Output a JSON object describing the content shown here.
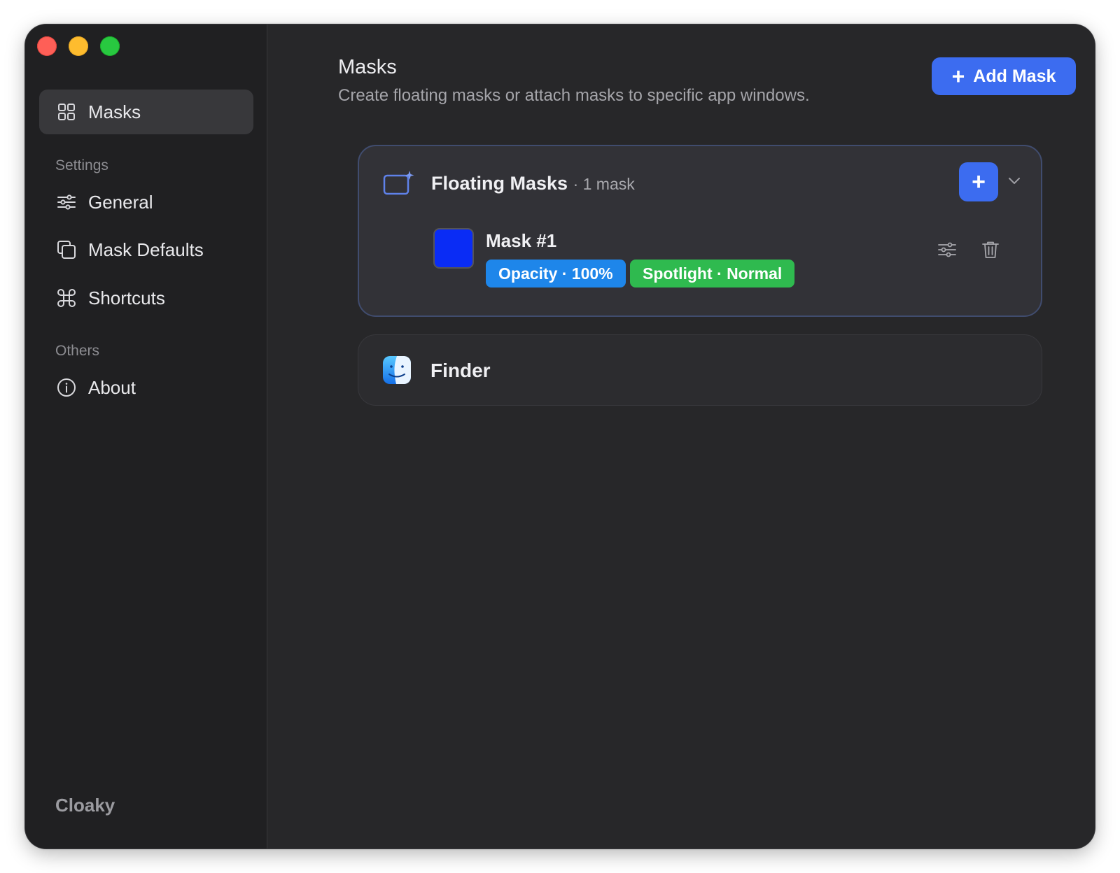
{
  "window": {
    "app_name": "Cloaky"
  },
  "sidebar": {
    "items": [
      {
        "label": "Masks",
        "icon": "grid-icon",
        "active": true
      }
    ],
    "sections": [
      {
        "label": "Settings",
        "items": [
          {
            "label": "General",
            "icon": "sliders-icon"
          },
          {
            "label": "Mask Defaults",
            "icon": "copy-icon"
          },
          {
            "label": "Shortcuts",
            "icon": "command-icon"
          }
        ]
      },
      {
        "label": "Others",
        "items": [
          {
            "label": "About",
            "icon": "info-icon"
          }
        ]
      }
    ]
  },
  "main": {
    "title": "Masks",
    "subtitle": "Create floating masks or attach masks to specific app windows.",
    "add_button": {
      "label": "Add Mask",
      "icon": "plus-icon"
    },
    "groups": [
      {
        "title": "Floating Masks",
        "count": "· 1 mask",
        "icon": "floating-window-sparkle-icon",
        "expanded": true,
        "masks": [
          {
            "name": "Mask #1",
            "color": "#0a2cf5",
            "badges": [
              {
                "text": "Opacity · 100%",
                "color": "#1e86ea"
              },
              {
                "text": "Spotlight · Normal",
                "color": "#2fba4f"
              }
            ]
          }
        ]
      },
      {
        "title": "Finder",
        "icon": "finder-app-icon"
      }
    ]
  },
  "colors": {
    "accent": "#3c6cf0",
    "background": "#272729",
    "sidebar": "#202022"
  }
}
